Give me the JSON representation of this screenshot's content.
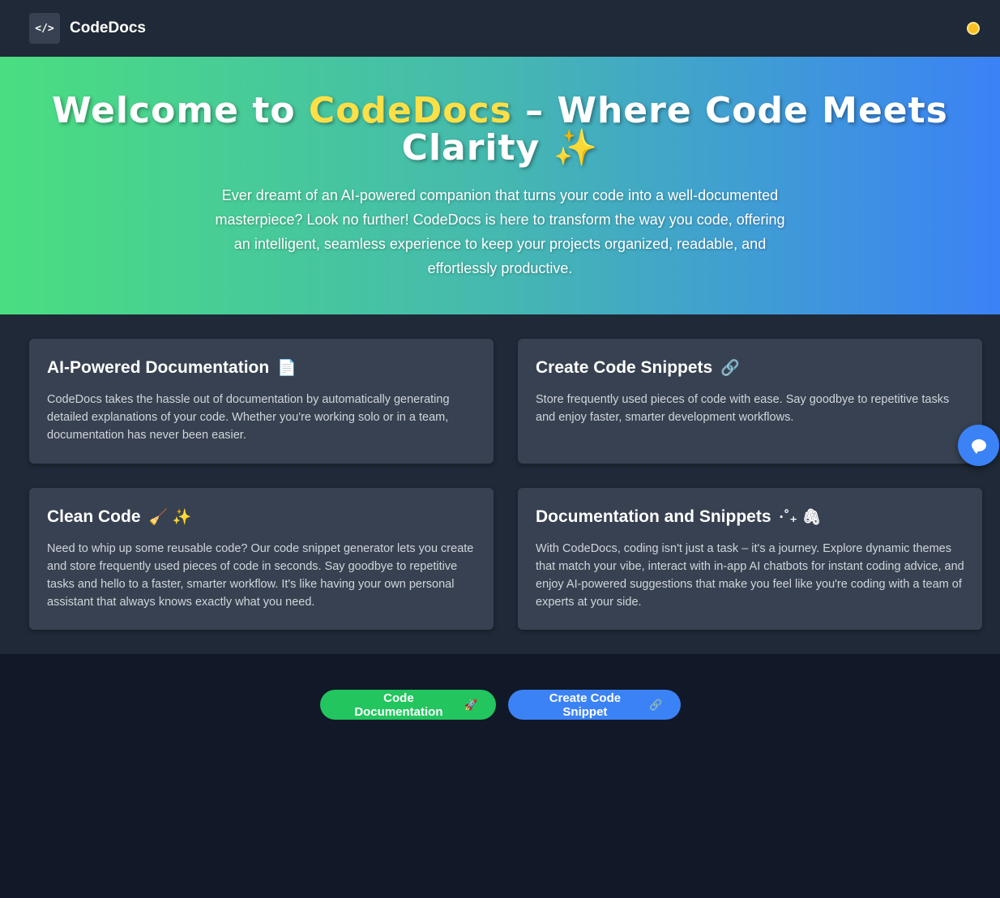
{
  "header": {
    "logo_glyph": "</>",
    "brand": "CodeDocs",
    "theme_toggle_icon": "sun-icon"
  },
  "hero": {
    "title_prefix": "Welcome to ",
    "title_accent": "CodeDocs",
    "title_suffix": " – Where Code Meets Clarity ✨",
    "description": "Ever dreamt of an AI-powered companion that turns your code into a well-documented masterpiece? Look no further! CodeDocs is here to transform the way you code, offering an intelligent, seamless experience to keep your projects organized, readable, and effortlessly productive."
  },
  "features": [
    {
      "title": "AI-Powered Documentation",
      "emoji": "📄",
      "text": "CodeDocs takes the hassle out of documentation by automatically generating detailed explanations of your code. Whether you're working solo or in a team, documentation has never been easier."
    },
    {
      "title": "Create Code Snippets",
      "emoji": "🔗",
      "text": "Store frequently used pieces of code with ease. Say goodbye to repetitive tasks and enjoy faster, smarter development workflows."
    },
    {
      "title": "Clean Code",
      "emoji": "🧹 ✨",
      "text": "Need to whip up some reusable code? Our code snippet generator lets you create and store frequently used pieces of code in seconds. Say goodbye to repetitive tasks and hello to a faster, smarter workflow. It's like having your own personal assistant that always knows exactly what you need."
    },
    {
      "title": "Documentation and Snippets",
      "emoji": "·˚₊ 🖇",
      "text": "With CodeDocs, coding isn't just a task – it's a journey. Explore dynamic themes that match your vibe, interact with in-app AI chatbots for instant coding advice, and enjoy AI-powered suggestions that make you feel like you're coding with a team of experts at your side."
    }
  ],
  "actions": {
    "doc_button": "Code Documentation",
    "doc_emoji": "🚀",
    "snippet_button": "Create Code Snippet",
    "snippet_emoji": "🔗"
  },
  "chat": {
    "icon": "chat-bubble-icon"
  },
  "colors": {
    "primary_bg": "#111827",
    "header_bg": "#1f2937",
    "card_bg": "#374151",
    "accent_yellow": "#fde047",
    "green": "#22c55e",
    "blue": "#3b82f6"
  }
}
